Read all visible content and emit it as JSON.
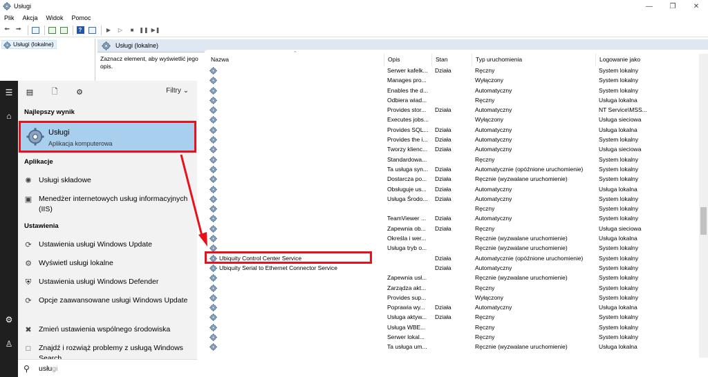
{
  "window": {
    "title": "Usługi"
  },
  "menubar": [
    "Plik",
    "Akcja",
    "Widok",
    "Pomoc"
  ],
  "tree": {
    "root_label": "Usługi (lokalne)"
  },
  "panel": {
    "title": "Usługi (lokalne)",
    "description": "Zaznacz element, aby wyświetlić jego opis."
  },
  "table": {
    "columns": {
      "name": "Nazwa",
      "desc": "Opis",
      "state": "Stan",
      "startup": "Typ uruchomienia",
      "logon": "Logowanie jako"
    },
    "rows": [
      {
        "name": "",
        "desc": "Serwer kafelk...",
        "state": "Działa",
        "startup": "Ręczny",
        "logon": "System lokalny"
      },
      {
        "name": "",
        "desc": "Manages pro...",
        "state": "",
        "startup": "Wyłączony",
        "logon": "System lokalny"
      },
      {
        "name": "",
        "desc": "Enables the d...",
        "state": "",
        "startup": "Automatyczny",
        "logon": "System lokalny"
      },
      {
        "name": "",
        "desc": "Odbiera wiad...",
        "state": "",
        "startup": "Ręczny",
        "logon": "Usługa lokalna"
      },
      {
        "name": "",
        "desc": "Provides stor...",
        "state": "Działa",
        "startup": "Automatyczny",
        "logon": "NT Service\\MSS..."
      },
      {
        "name": "",
        "desc": "Executes jobs...",
        "state": "",
        "startup": "Wyłączony",
        "logon": "Usługa sieciowa"
      },
      {
        "name": "",
        "desc": "Provides SQL...",
        "state": "Działa",
        "startup": "Automatyczny",
        "logon": "Usługa lokalna"
      },
      {
        "name": "",
        "desc": "Provides the i...",
        "state": "Działa",
        "startup": "Automatyczny",
        "logon": "System lokalny"
      },
      {
        "name": "",
        "desc": "Tworzy klienc...",
        "state": "Działa",
        "startup": "Automatyczny",
        "logon": "Usługa sieciowa"
      },
      {
        "name": "",
        "desc": "Standardowa...",
        "state": "",
        "startup": "Ręczny",
        "logon": "System lokalny"
      },
      {
        "name": "",
        "desc": "Ta usługa syn...",
        "state": "Działa",
        "startup": "Automatycznie (opóźnione uruchomienie)",
        "logon": "System lokalny"
      },
      {
        "name": "",
        "desc": "Dostarcza po...",
        "state": "Działa",
        "startup": "Ręcznie (wyzwalane uruchomienie)",
        "logon": "System lokalny"
      },
      {
        "name": "",
        "desc": "Obsługuje us...",
        "state": "Działa",
        "startup": "Automatyczny",
        "logon": "Usługa lokalna"
      },
      {
        "name": "",
        "desc": "Usługa Środo...",
        "state": "Działa",
        "startup": "Automatyczny",
        "logon": "System lokalny"
      },
      {
        "name": "",
        "desc": "",
        "state": "",
        "startup": "Ręczny",
        "logon": "System lokalny"
      },
      {
        "name": "",
        "desc": "TeamViewer ...",
        "state": "Działa",
        "startup": "Automatyczny",
        "logon": "System lokalny"
      },
      {
        "name": "",
        "desc": "Zapewnia ob...",
        "state": "Działa",
        "startup": "Ręczny",
        "logon": "Usługa sieciowa"
      },
      {
        "name": "",
        "desc": "Określa i wer...",
        "state": "",
        "startup": "Ręcznie (wyzwalane uruchomienie)",
        "logon": "Usługa lokalna"
      },
      {
        "name": "",
        "desc": "Usługa tryb o...",
        "state": "",
        "startup": "Ręcznie (wyzwalane uruchomienie)",
        "logon": "System lokalny"
      },
      {
        "name": "Ubiquity Control Center Service",
        "desc": "",
        "state": "Działa",
        "startup": "Automatycznie (opóźnione uruchomienie)",
        "logon": "System lokalny"
      },
      {
        "name": "Ubiquity Serial to Ethernet Connector Service",
        "desc": "",
        "state": "Działa",
        "startup": "Automatyczny",
        "logon": "System lokalny"
      },
      {
        "name": "",
        "desc": "Zapewnia usł...",
        "state": "",
        "startup": "Ręcznie (wyzwalane uruchomienie)",
        "logon": "System lokalny"
      },
      {
        "name": "",
        "desc": "Zarządza akt...",
        "state": "",
        "startup": "Ręczny",
        "logon": "System lokalny"
      },
      {
        "name": "",
        "desc": "Provides sup...",
        "state": "",
        "startup": "Wyłączony",
        "logon": "System lokalny"
      },
      {
        "name": "",
        "desc": "Poprawia wy...",
        "state": "Działa",
        "startup": "Automatyczny",
        "logon": "Usługa lokalna"
      },
      {
        "name": "",
        "desc": "Usługa aktyw...",
        "state": "Działa",
        "startup": "Ręczny",
        "logon": "System lokalny"
      },
      {
        "name": "",
        "desc": "Usługa WBE...",
        "state": "",
        "startup": "Ręczny",
        "logon": "System lokalny"
      },
      {
        "name": "",
        "desc": "Serwer lokal...",
        "state": "",
        "startup": "Ręczny",
        "logon": "System lokalny"
      },
      {
        "name": "",
        "desc": "Ta usługa um...",
        "state": "",
        "startup": "Ręcznie (wyzwalane uruchomienie)",
        "logon": "Usługa lokalna"
      }
    ]
  },
  "start": {
    "filters_label": "Filtry",
    "best_heading": "Najlepszy wynik",
    "best_title": "Usługi",
    "best_subtitle": "Aplikacja komputerowa",
    "apps_heading": "Aplikacje",
    "apps": [
      {
        "label": "Usługi składowe",
        "icon": "component-services-icon"
      },
      {
        "label": "Menedżer internetowych usług informacyjnych (IIS)",
        "icon": "iis-manager-icon"
      }
    ],
    "settings_heading": "Ustawienia",
    "settings": [
      {
        "label": "Ustawienia usługi Windows Update",
        "icon": "refresh-icon"
      },
      {
        "label": "Wyświetl usługi lokalne",
        "icon": "services-gear-icon"
      },
      {
        "label": "Ustawienia usługi Windows Defender",
        "icon": "shield-icon"
      },
      {
        "label": "Opcje zaawansowane usługi Windows Update",
        "icon": "refresh-icon"
      },
      {
        "label": "Zmień ustawienia wspólnego środowiska",
        "icon": "shared-experience-icon"
      },
      {
        "label": "Znajdź i rozwiąż problemy z usługą Windows Search",
        "icon": "troubleshoot-icon"
      }
    ],
    "search": {
      "typed": "usłu",
      "suggestion": "gi"
    }
  },
  "colors": {
    "highlight_red": "#e8101b",
    "selection_blue": "#a8cfee",
    "rail_dark": "#1f1f1f",
    "panel_header": "#dfe8f2"
  }
}
